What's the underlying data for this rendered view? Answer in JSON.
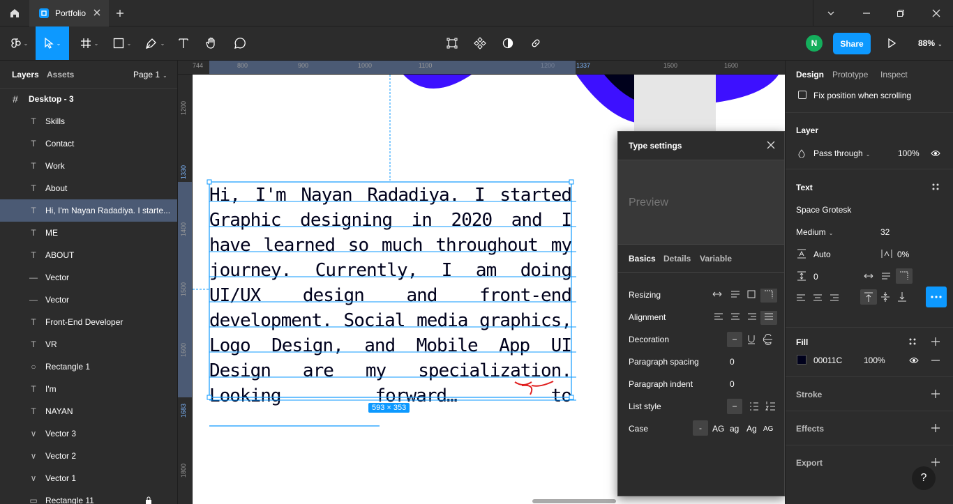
{
  "titlebar": {
    "file_name": "Portfolio"
  },
  "toolbar": {
    "avatar_initial": "N",
    "share_label": "Share",
    "zoom": "88%"
  },
  "left_panel": {
    "tab_layers": "Layers",
    "tab_assets": "Assets",
    "page": "Page 1",
    "frame": "Desktop - 3",
    "layers": [
      {
        "icon": "T",
        "name": "Skills"
      },
      {
        "icon": "T",
        "name": "Contact"
      },
      {
        "icon": "T",
        "name": "Work"
      },
      {
        "icon": "T",
        "name": "About"
      },
      {
        "icon": "T",
        "name": "Hi, I'm Nayan Radadiya. I starte..."
      },
      {
        "icon": "T",
        "name": "ME"
      },
      {
        "icon": "T",
        "name": "ABOUT"
      },
      {
        "icon": "—",
        "name": "Vector"
      },
      {
        "icon": "—",
        "name": "Vector"
      },
      {
        "icon": "T",
        "name": "Front-End Developer"
      },
      {
        "icon": "T",
        "name": "VR"
      },
      {
        "icon": "○",
        "name": "Rectangle 1"
      },
      {
        "icon": "T",
        "name": "I'm"
      },
      {
        "icon": "T",
        "name": "NAYAN"
      },
      {
        "icon": "∨",
        "name": "Vector 3"
      },
      {
        "icon": "∨",
        "name": "Vector 2"
      },
      {
        "icon": "∨",
        "name": "Vector 1"
      },
      {
        "icon": "▭",
        "name": "Rectangle 11"
      }
    ]
  },
  "rulers": {
    "top": [
      "744",
      "800",
      "900",
      "1000",
      "1100",
      "1200",
      "1337",
      "1500",
      "1600"
    ],
    "left": [
      "1200",
      "1330",
      "1400",
      "1500",
      "1600",
      "1683",
      "1800"
    ]
  },
  "canvas": {
    "body_text": "Hi, I'm Nayan Radadiya. I started Graphic designing in 2020 and I have learned so much throughout my journey. Currently, I am doing UI/UX design and front-end development. Social media graphics, Logo Design, and Mobile App UI Design are my specialization. Looking forward… to",
    "size_badge": "593 × 353"
  },
  "type_settings": {
    "title": "Type settings",
    "preview": "Preview",
    "tabs": [
      "Basics",
      "Details",
      "Variable"
    ],
    "resizing": "Resizing",
    "alignment": "Alignment",
    "decoration": "Decoration",
    "paragraph_spacing": "Paragraph spacing",
    "paragraph_spacing_value": "0",
    "paragraph_indent": "Paragraph indent",
    "paragraph_indent_value": "0",
    "list_style": "List style",
    "case": "Case",
    "case_options": [
      "AG",
      "ag",
      "Ag",
      "AG"
    ]
  },
  "right_panel": {
    "tabs": [
      "Design",
      "Prototype",
      "Inspect"
    ],
    "fix_position": "Fix position when scrolling",
    "layer_title": "Layer",
    "blend": "Pass through",
    "layer_opacity": "100%",
    "text_title": "Text",
    "font": "Space Grotesk",
    "weight": "Medium",
    "size": "32",
    "line_height": "Auto",
    "letter_spacing": "0%",
    "para_spacing": "0",
    "fill_title": "Fill",
    "fill_hex": "00011C",
    "fill_opacity": "100%",
    "stroke_title": "Stroke",
    "effects_title": "Effects",
    "export_title": "Export"
  },
  "colors": {
    "accent": "#0d99ff",
    "fill": "#00011c",
    "canvas_shape": "#3d10ff",
    "selection_row": "#4b5a74"
  }
}
